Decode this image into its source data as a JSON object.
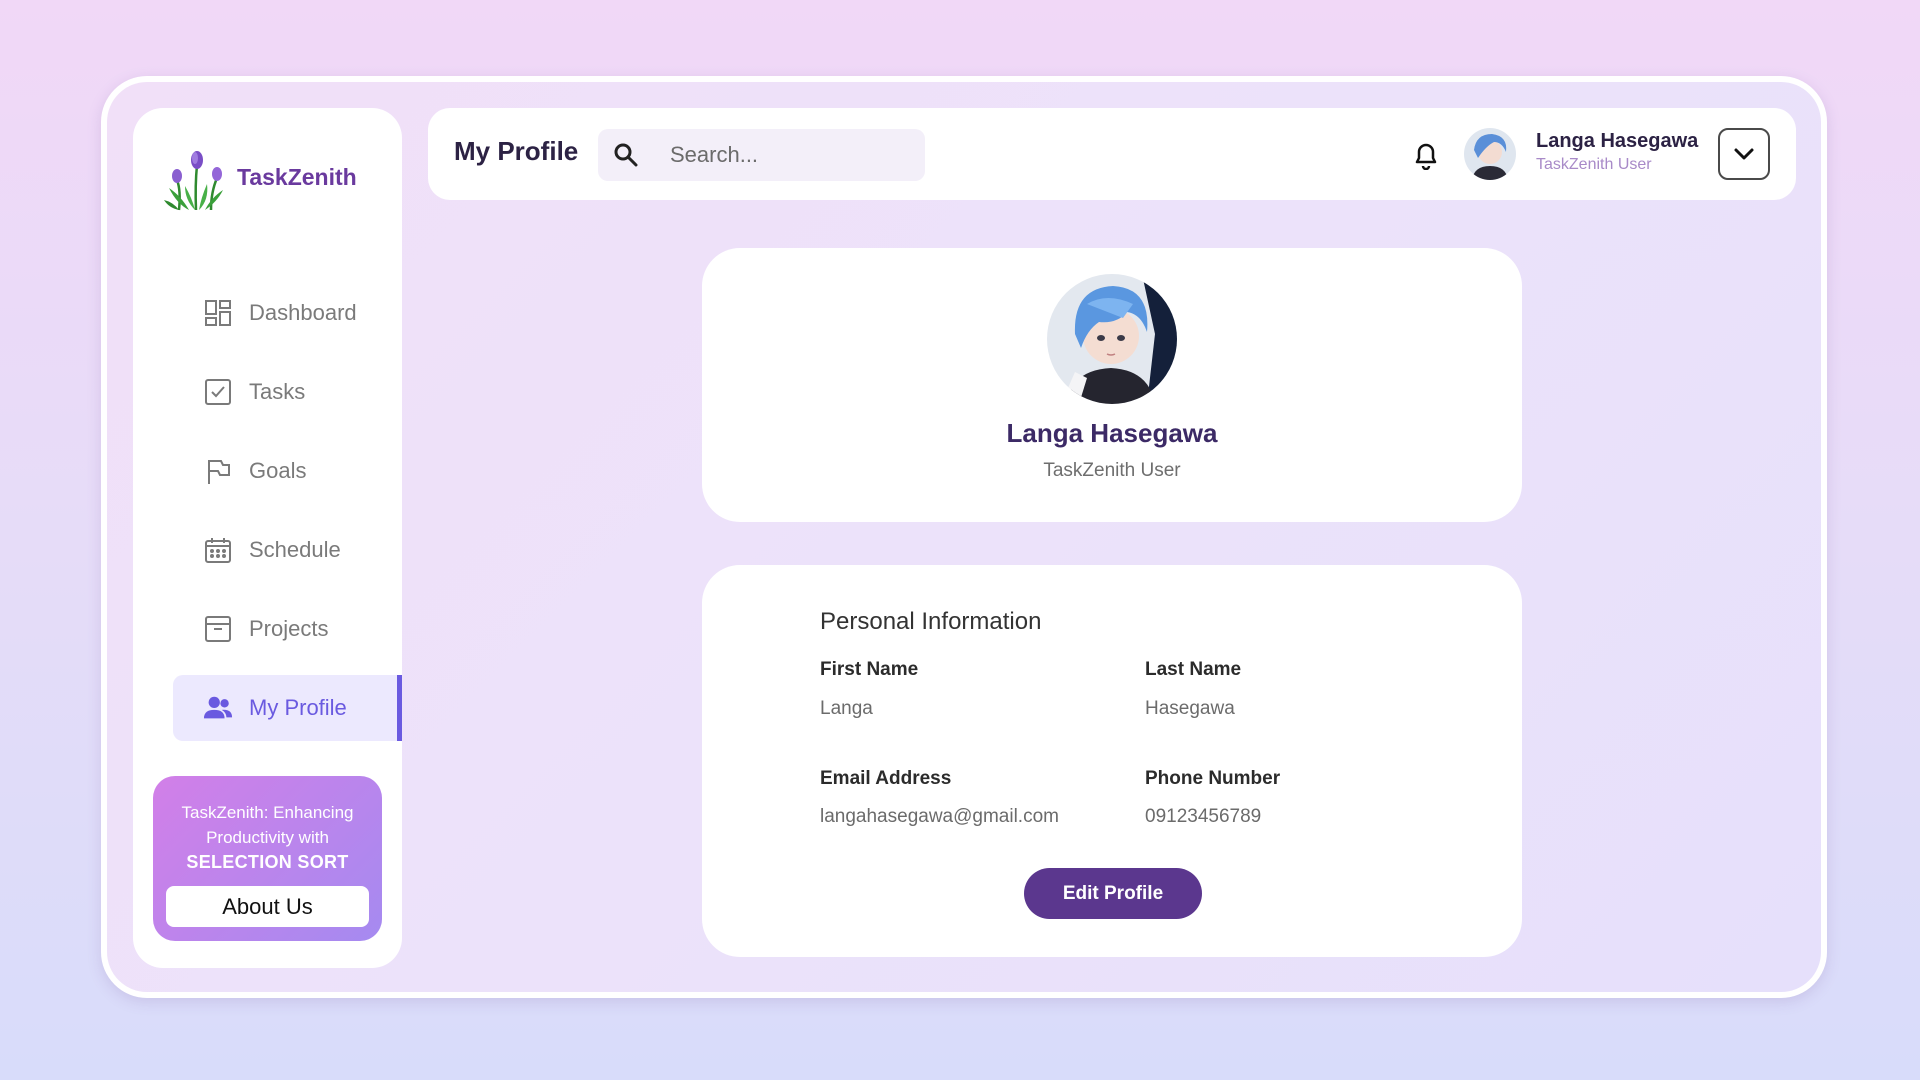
{
  "brand": {
    "name": "TaskZenith"
  },
  "sidebar": {
    "items": [
      {
        "label": "Dashboard",
        "icon": "dashboard-icon"
      },
      {
        "label": "Tasks",
        "icon": "checkbox-icon"
      },
      {
        "label": "Goals",
        "icon": "flag-icon"
      },
      {
        "label": "Schedule",
        "icon": "calendar-icon"
      },
      {
        "label": "Projects",
        "icon": "archive-icon"
      },
      {
        "label": "My Profile",
        "icon": "users-icon",
        "active": true
      }
    ],
    "promo": {
      "line1": "TaskZenith: Enhancing",
      "line2": "Productivity with",
      "line3": "SELECTION SORT",
      "button_label": "About Us"
    }
  },
  "header": {
    "title": "My Profile",
    "search_placeholder": "Search...",
    "user_name": "Langa Hasegawa",
    "user_role": "TaskZenith User"
  },
  "profile": {
    "name": "Langa Hasegawa",
    "role": "TaskZenith User"
  },
  "personal_info": {
    "title": "Personal Information",
    "first_name_label": "First Name",
    "first_name": "Langa",
    "last_name_label": "Last Name",
    "last_name": "Hasegawa",
    "email_label": "Email Address",
    "email": "langahasegawa@gmail.com",
    "phone_label": "Phone Number",
    "phone": "09123456789",
    "edit_button": "Edit Profile"
  },
  "colors": {
    "accent": "#6a5ae0",
    "brand": "#6a3a9e",
    "button": "#5b378e"
  }
}
